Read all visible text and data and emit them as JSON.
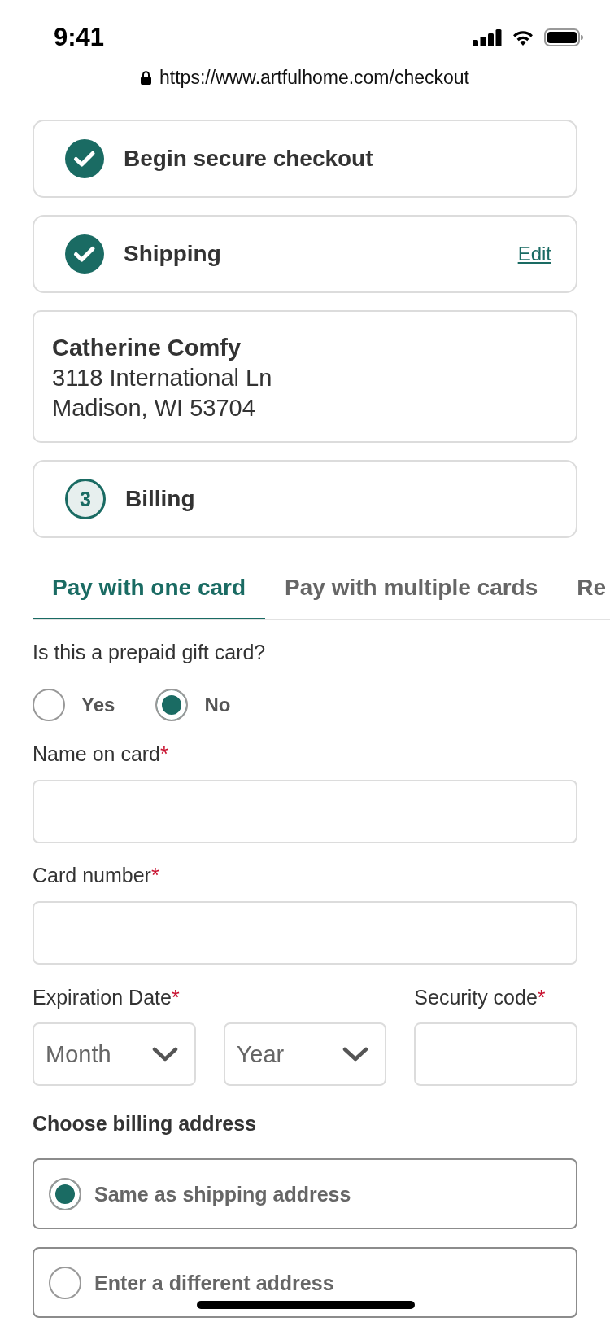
{
  "status_bar": {
    "time": "9:41"
  },
  "browser": {
    "url": "https://www.artfulhome.com/checkout"
  },
  "steps": [
    {
      "title": "Begin secure checkout",
      "completed": true
    },
    {
      "title": "Shipping",
      "completed": true,
      "action": "Edit",
      "summary": {
        "name": "Catherine Comfy",
        "lines": [
          "3118 International Ln",
          "Madison, WI 53704"
        ]
      }
    },
    {
      "number": "3",
      "title": "Billing",
      "completed": false
    }
  ],
  "payment_tabs": [
    {
      "label": "Pay with one card",
      "selected": true
    },
    {
      "label": "Pay with multiple cards",
      "selected": false
    },
    {
      "label": "Re",
      "selected": false
    }
  ],
  "gift_card": {
    "question": "Is this a prepaid gift card?",
    "options": [
      {
        "label": "Yes",
        "selected": false
      },
      {
        "label": "No",
        "selected": true
      }
    ]
  },
  "card_fields": {
    "name_on_card": {
      "label": "Name on card",
      "required_mark": "*"
    },
    "card_number": {
      "label": "Card number",
      "required_mark": "*"
    },
    "expiration_date": {
      "label": "Expiration Date",
      "required_mark": "*",
      "month": {
        "placeholder": "Month"
      },
      "year": {
        "placeholder": "Year"
      }
    },
    "security_code": {
      "label": "Security code",
      "required_mark": "*"
    }
  },
  "billing_address": {
    "title": "Choose billing address",
    "options": [
      {
        "label": "Same as shipping address",
        "selected": true
      },
      {
        "label": "Enter a different address",
        "selected": false
      }
    ]
  }
}
